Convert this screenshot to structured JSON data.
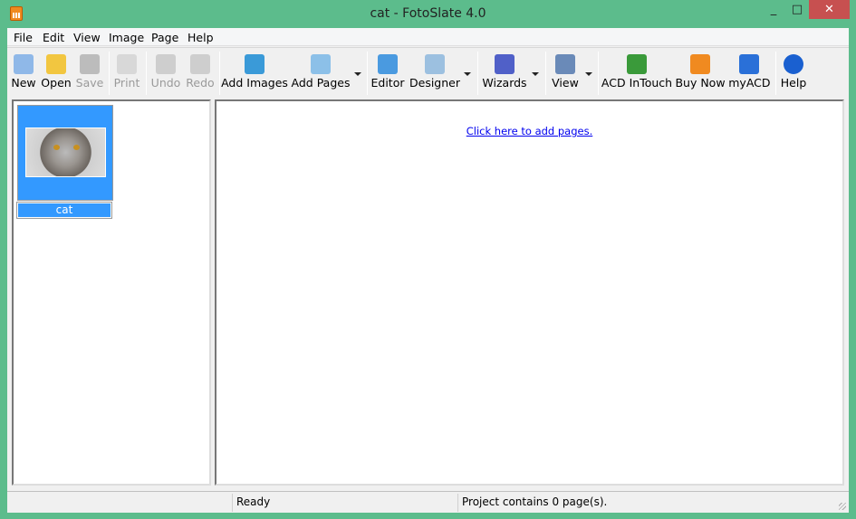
{
  "window": {
    "title": "cat - FotoSlate 4.0",
    "controls": {
      "minimize": "_",
      "maximize": "□",
      "close": "✕"
    }
  },
  "menu": [
    "File",
    "Edit",
    "View",
    "Image",
    "Page",
    "Help"
  ],
  "toolbar": [
    {
      "label": "New",
      "icon": "new-document-icon",
      "enabled": true
    },
    {
      "label": "Open",
      "icon": "folder-open-icon",
      "enabled": true
    },
    {
      "label": "Save",
      "icon": "floppy-disk-icon",
      "enabled": false
    },
    {
      "label": "Print",
      "icon": "printer-icon",
      "enabled": false
    },
    {
      "label": "Undo",
      "icon": "undo-icon",
      "enabled": false
    },
    {
      "label": "Redo",
      "icon": "redo-icon",
      "enabled": false
    },
    {
      "label": "Add Images",
      "icon": "add-images-icon",
      "enabled": true
    },
    {
      "label": "Add Pages",
      "icon": "add-pages-icon",
      "enabled": true,
      "dropdown": true
    },
    {
      "label": "Editor",
      "icon": "editor-icon",
      "enabled": true
    },
    {
      "label": "Designer",
      "icon": "designer-icon",
      "enabled": true,
      "dropdown": true
    },
    {
      "label": "Wizards",
      "icon": "wizard-hat-icon",
      "enabled": true,
      "dropdown": true
    },
    {
      "label": "View",
      "icon": "eye-icon",
      "enabled": true,
      "dropdown": true
    },
    {
      "label": "ACD InTouch",
      "icon": "globe-hand-icon",
      "enabled": true
    },
    {
      "label": "Buy Now",
      "icon": "shopping-cart-icon",
      "enabled": true
    },
    {
      "label": "myACD",
      "icon": "plug-icon",
      "enabled": true
    },
    {
      "label": "Help",
      "icon": "help-icon",
      "enabled": true
    }
  ],
  "images": [
    {
      "name": "cat",
      "selected": true
    }
  ],
  "main": {
    "add_pages_link": "Click here to add pages."
  },
  "status": {
    "left": "",
    "middle": "Ready",
    "right": "Project contains 0 page(s)."
  },
  "colors": {
    "frame": "#5cbc8c",
    "close": "#c75050",
    "selection": "#3399ff",
    "link": "#0000ee"
  }
}
